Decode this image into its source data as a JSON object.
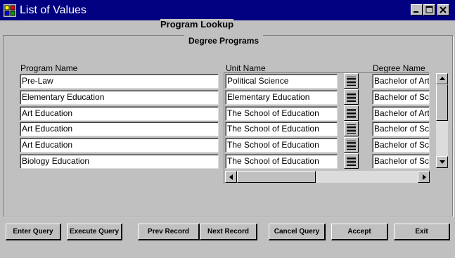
{
  "window": {
    "title": "List of Values"
  },
  "page": {
    "heading": "Program Lookup",
    "section_title": "Degree Programs"
  },
  "columns": {
    "program": "Program Name",
    "unit": "Unit Name",
    "degree": "Degree Name"
  },
  "rows": [
    {
      "program": "Pre-Law",
      "unit": "Political Science",
      "degree": "Bachelor of Arts"
    },
    {
      "program": "Elementary Education",
      "unit": "Elementary Education",
      "degree": "Bachelor of Science"
    },
    {
      "program": "Art Education",
      "unit": "The School of Education",
      "degree": "Bachelor of Arts"
    },
    {
      "program": "Art Education",
      "unit": "The School of Education",
      "degree": "Bachelor of Science"
    },
    {
      "program": "Art Education",
      "unit": "The School of Education",
      "degree": "Bachelor of Science"
    },
    {
      "program": "Biology Education",
      "unit": "The School of Education",
      "degree": "Bachelor of Science"
    }
  ],
  "buttons": {
    "enter_query": "Enter Query",
    "execute_query": "Execute Query",
    "prev_record": "Prev Record",
    "next_record": "Next Record",
    "cancel_query": "Cancel Query",
    "accept": "Accept",
    "exit": "Exit"
  }
}
